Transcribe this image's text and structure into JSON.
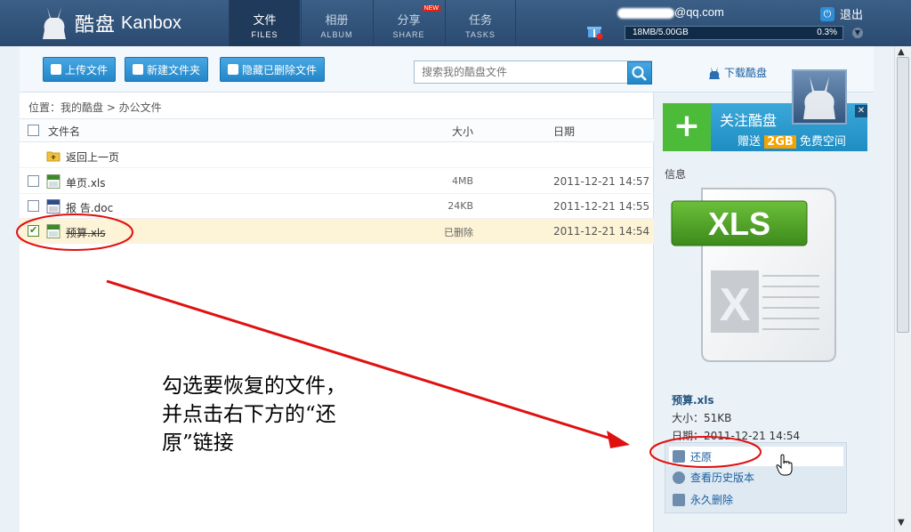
{
  "app": {
    "logo_cn": "酷盘",
    "logo_en": "Kanbox"
  },
  "nav": [
    {
      "cn": "文件",
      "en": "FILES",
      "active": true
    },
    {
      "cn": "相册",
      "en": "ALBUM"
    },
    {
      "cn": "分享",
      "en": "SHARE",
      "badge": "NEW"
    },
    {
      "cn": "任务",
      "en": "TASKS"
    }
  ],
  "account": {
    "email_suffix": "@qq.com",
    "logout": "退出",
    "quota": "18MB/5.00GB",
    "quota_percent": "0.3%",
    "quota_fraction": 0.003
  },
  "toolbar": {
    "upload": "上传文件",
    "new_folder": "新建文件夹",
    "hide_deleted": "隐藏已删除文件",
    "search_placeholder": "搜索我的酷盘文件",
    "download": "下载酷盘"
  },
  "breadcrumb": "位置：我的酷盘 > 办公文件",
  "columns": {
    "name": "文件名",
    "size": "大小",
    "date": "日期"
  },
  "back": "返回上一页",
  "files": [
    {
      "name": "单页.xls",
      "size": "4MB",
      "date": "2011-12-21 14:57",
      "checked": false,
      "type": "XLS"
    },
    {
      "name": "报 告.doc",
      "size": "24KB",
      "date": "2011-12-21 14:55",
      "checked": false,
      "type": "DOC"
    },
    {
      "name": "预算.xls",
      "size": "已删除",
      "date": "2011-12-21 14:54",
      "checked": true,
      "type": "XLS",
      "deleted": true
    }
  ],
  "banner": {
    "line1": "关注酷盘",
    "gift_prefix": "赠送",
    "gift": "2GB",
    "gift_suffix": "免费空间"
  },
  "info": {
    "label": "信息",
    "icon_label": "XLS",
    "name": "预算.xls",
    "size": "大小：51KB",
    "date": "日期：2011-12-21 14:54"
  },
  "actions": {
    "restore": "还原",
    "history": "查看历史版本",
    "delete": "永久删除"
  },
  "annotation": [
    "勾选要恢复的文件，",
    "并点击右下方的“还",
    "原”链接"
  ],
  "colors": {
    "nav_bg": "#2a4a70",
    "button": "#2286c8",
    "highlight_row": "#fdf3d6",
    "annotation_red": "#e01010"
  }
}
